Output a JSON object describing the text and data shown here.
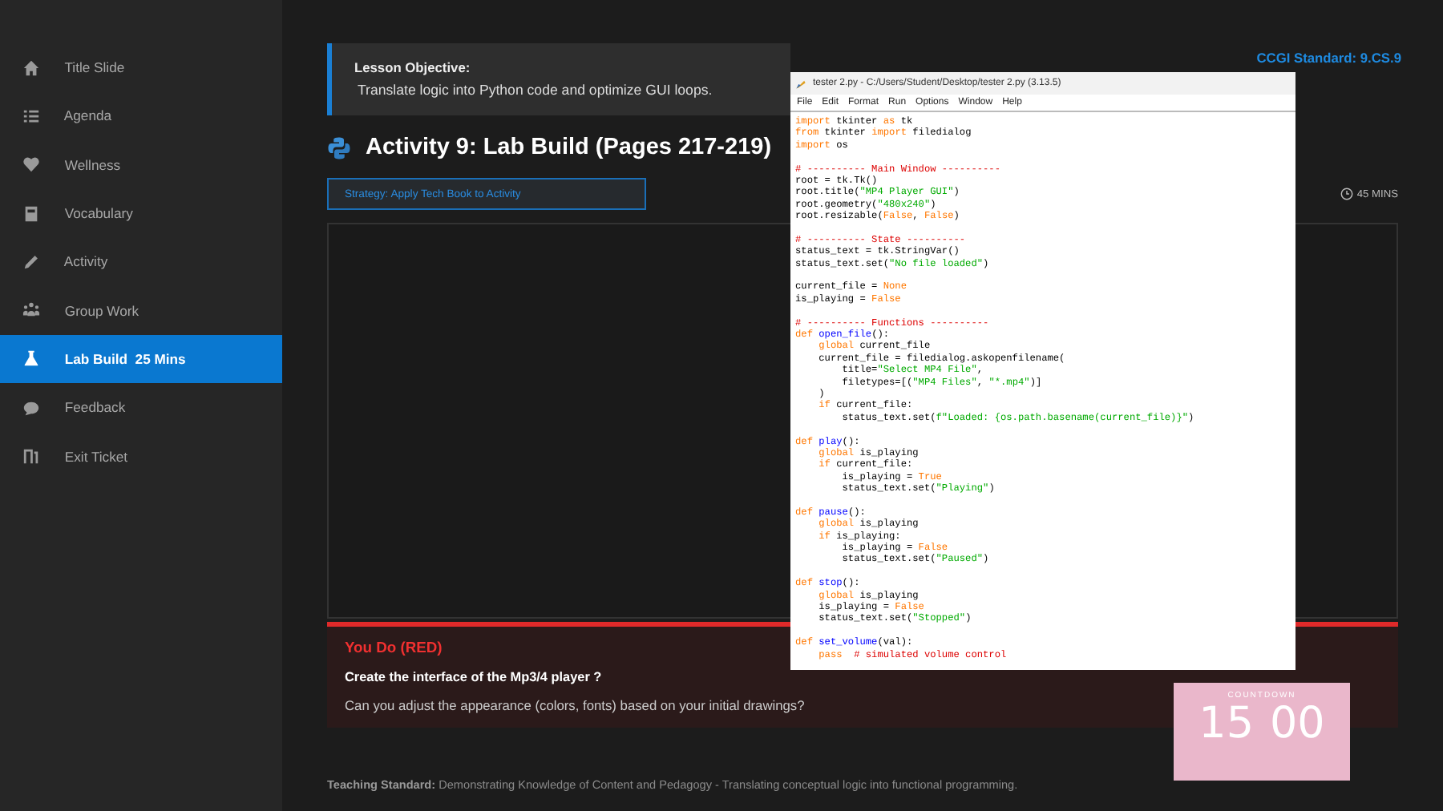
{
  "sidebar": {
    "items": [
      {
        "label": "Title Slide",
        "selected": false
      },
      {
        "label": "Agenda",
        "selected": false
      },
      {
        "label": "Wellness",
        "selected": false
      },
      {
        "label": "Vocabulary",
        "selected": false
      },
      {
        "label": "Activity",
        "selected": false
      },
      {
        "label": "Group Work",
        "selected": false
      },
      {
        "label": "Lab Build  25 Mins",
        "selected": true
      },
      {
        "label": "Feedback",
        "selected": false
      },
      {
        "label": "Exit Ticket",
        "selected": false
      }
    ]
  },
  "objective": {
    "heading": "Lesson Objective:",
    "text": "Translate logic into Python code and optimize GUI loops."
  },
  "standard_tag": "CCGI Standard: 9.CS.9",
  "title": "Activity 9: Lab Build (Pages 217-219)",
  "strategy_button": "Strategy: Apply Tech Book to Activity",
  "duration": "45 MINS",
  "editor": {
    "title": "tester 2.py - C:/Users/Student/Desktop/tester 2.py (3.13.5)",
    "menu": [
      "File",
      "Edit",
      "Format",
      "Run",
      "Options",
      "Window",
      "Help"
    ],
    "lines": [
      {
        "kind": "code",
        "segments": [
          {
            "kind": "keyword",
            "text": "import"
          },
          {
            "kind": "plain",
            "text": " tkinter "
          },
          {
            "kind": "keyword",
            "text": "as"
          },
          {
            "kind": "plain",
            "text": " tk"
          }
        ]
      },
      {
        "kind": "code",
        "segments": [
          {
            "kind": "keyword",
            "text": "from"
          },
          {
            "kind": "plain",
            "text": " tkinter "
          },
          {
            "kind": "keyword",
            "text": "import"
          },
          {
            "kind": "plain",
            "text": " filedialog"
          }
        ]
      },
      {
        "kind": "code",
        "segments": [
          {
            "kind": "keyword",
            "text": "import"
          },
          {
            "kind": "plain",
            "text": " os"
          }
        ]
      },
      {
        "kind": "blank"
      },
      {
        "kind": "code",
        "segments": [
          {
            "kind": "comment",
            "text": "# ---------- Main Window ----------"
          }
        ]
      },
      {
        "kind": "code",
        "segments": [
          {
            "kind": "plain",
            "text": "root = tk.Tk()"
          }
        ]
      },
      {
        "kind": "code",
        "segments": [
          {
            "kind": "plain",
            "text": "root.title("
          },
          {
            "kind": "string",
            "text": "\"MP4 Player GUI\""
          },
          {
            "kind": "plain",
            "text": ")"
          }
        ]
      },
      {
        "kind": "code",
        "segments": [
          {
            "kind": "plain",
            "text": "root.geometry("
          },
          {
            "kind": "string",
            "text": "\"480x240\""
          },
          {
            "kind": "plain",
            "text": ")"
          }
        ]
      },
      {
        "kind": "code",
        "segments": [
          {
            "kind": "plain",
            "text": "root.resizable("
          },
          {
            "kind": "keyword",
            "text": "False"
          },
          {
            "kind": "plain",
            "text": ", "
          },
          {
            "kind": "keyword",
            "text": "False"
          },
          {
            "kind": "plain",
            "text": ")"
          }
        ]
      },
      {
        "kind": "blank"
      },
      {
        "kind": "code",
        "segments": [
          {
            "kind": "comment",
            "text": "# ---------- State ----------"
          }
        ]
      },
      {
        "kind": "code",
        "segments": [
          {
            "kind": "plain",
            "text": "status_text = tk.StringVar()"
          }
        ]
      },
      {
        "kind": "code",
        "segments": [
          {
            "kind": "plain",
            "text": "status_text.set("
          },
          {
            "kind": "string",
            "text": "\"No file loaded\""
          },
          {
            "kind": "plain",
            "text": ")"
          }
        ]
      },
      {
        "kind": "blank"
      },
      {
        "kind": "code",
        "segments": [
          {
            "kind": "plain",
            "text": "current_file = "
          },
          {
            "kind": "keyword",
            "text": "None"
          }
        ]
      },
      {
        "kind": "code",
        "segments": [
          {
            "kind": "plain",
            "text": "is_playing = "
          },
          {
            "kind": "keyword",
            "text": "False"
          }
        ]
      },
      {
        "kind": "blank"
      },
      {
        "kind": "code",
        "segments": [
          {
            "kind": "comment",
            "text": "# ---------- Functions ----------"
          }
        ]
      },
      {
        "kind": "code",
        "segments": [
          {
            "kind": "keyword",
            "text": "def"
          },
          {
            "kind": "name",
            "text": " open_file"
          },
          {
            "kind": "plain",
            "text": "():"
          }
        ]
      },
      {
        "kind": "code",
        "segments": [
          {
            "kind": "keyword",
            "text": "    global"
          },
          {
            "kind": "plain",
            "text": " current_file"
          }
        ]
      },
      {
        "kind": "code",
        "segments": [
          {
            "kind": "plain",
            "text": "    current_file = filedialog.askopenfilename("
          }
        ]
      },
      {
        "kind": "code",
        "segments": [
          {
            "kind": "plain",
            "text": "        title="
          },
          {
            "kind": "string",
            "text": "\"Select MP4 File\""
          },
          {
            "kind": "plain",
            "text": ","
          }
        ]
      },
      {
        "kind": "code",
        "segments": [
          {
            "kind": "plain",
            "text": "        filetypes=[("
          },
          {
            "kind": "string",
            "text": "\"MP4 Files\""
          },
          {
            "kind": "plain",
            "text": ", "
          },
          {
            "kind": "string",
            "text": "\"*.mp4\""
          },
          {
            "kind": "plain",
            "text": ")]"
          }
        ]
      },
      {
        "kind": "code",
        "segments": [
          {
            "kind": "plain",
            "text": "    )"
          }
        ]
      },
      {
        "kind": "code",
        "segments": [
          {
            "kind": "keyword",
            "text": "    if"
          },
          {
            "kind": "plain",
            "text": " current_file:"
          }
        ]
      },
      {
        "kind": "code",
        "segments": [
          {
            "kind": "plain",
            "text": "        status_text.set("
          },
          {
            "kind": "string",
            "text": "f\"Loaded: {os.path.basename(current_file)}\""
          },
          {
            "kind": "plain",
            "text": ")"
          }
        ]
      },
      {
        "kind": "blank"
      },
      {
        "kind": "code",
        "segments": [
          {
            "kind": "keyword",
            "text": "def"
          },
          {
            "kind": "name",
            "text": " play"
          },
          {
            "kind": "plain",
            "text": "():"
          }
        ]
      },
      {
        "kind": "code",
        "segments": [
          {
            "kind": "keyword",
            "text": "    global"
          },
          {
            "kind": "plain",
            "text": " is_playing"
          }
        ]
      },
      {
        "kind": "code",
        "segments": [
          {
            "kind": "keyword",
            "text": "    if"
          },
          {
            "kind": "plain",
            "text": " current_file:"
          }
        ]
      },
      {
        "kind": "code",
        "segments": [
          {
            "kind": "plain",
            "text": "        is_playing = "
          },
          {
            "kind": "keyword",
            "text": "True"
          }
        ]
      },
      {
        "kind": "code",
        "segments": [
          {
            "kind": "plain",
            "text": "        status_text.set("
          },
          {
            "kind": "string",
            "text": "\"Playing\""
          },
          {
            "kind": "plain",
            "text": ")"
          }
        ]
      },
      {
        "kind": "blank"
      },
      {
        "kind": "code",
        "segments": [
          {
            "kind": "keyword",
            "text": "def"
          },
          {
            "kind": "name",
            "text": " pause"
          },
          {
            "kind": "plain",
            "text": "():"
          }
        ]
      },
      {
        "kind": "code",
        "segments": [
          {
            "kind": "keyword",
            "text": "    global"
          },
          {
            "kind": "plain",
            "text": " is_playing"
          }
        ]
      },
      {
        "kind": "code",
        "segments": [
          {
            "kind": "keyword",
            "text": "    if"
          },
          {
            "kind": "plain",
            "text": " is_playing:"
          }
        ]
      },
      {
        "kind": "code",
        "segments": [
          {
            "kind": "plain",
            "text": "        is_playing = "
          },
          {
            "kind": "keyword",
            "text": "False"
          }
        ]
      },
      {
        "kind": "code",
        "segments": [
          {
            "kind": "plain",
            "text": "        status_text.set("
          },
          {
            "kind": "string",
            "text": "\"Paused\""
          },
          {
            "kind": "plain",
            "text": ")"
          }
        ]
      },
      {
        "kind": "blank"
      },
      {
        "kind": "code",
        "segments": [
          {
            "kind": "keyword",
            "text": "def"
          },
          {
            "kind": "name",
            "text": " stop"
          },
          {
            "kind": "plain",
            "text": "():"
          }
        ]
      },
      {
        "kind": "code",
        "segments": [
          {
            "kind": "keyword",
            "text": "    global"
          },
          {
            "kind": "plain",
            "text": " is_playing"
          }
        ]
      },
      {
        "kind": "code",
        "segments": [
          {
            "kind": "plain",
            "text": "    is_playing = "
          },
          {
            "kind": "keyword",
            "text": "False"
          }
        ]
      },
      {
        "kind": "code",
        "segments": [
          {
            "kind": "plain",
            "text": "    status_text.set("
          },
          {
            "kind": "string",
            "text": "\"Stopped\""
          },
          {
            "kind": "plain",
            "text": ")"
          }
        ]
      },
      {
        "kind": "blank"
      },
      {
        "kind": "code",
        "segments": [
          {
            "kind": "keyword",
            "text": "def"
          },
          {
            "kind": "name",
            "text": " set_volume"
          },
          {
            "kind": "plain",
            "text": "(val):"
          }
        ]
      },
      {
        "kind": "code",
        "segments": [
          {
            "kind": "keyword",
            "text": "    pass"
          },
          {
            "kind": "comment",
            "text": "  # simulated volume control"
          }
        ]
      }
    ]
  },
  "you_do": {
    "heading": "You Do (RED)",
    "task": "Create the interface of the Mp3/4 player ?",
    "question": "Can you adjust the appearance (colors, fonts) based on your initial drawings?"
  },
  "countdown": {
    "label": "COUNTDOWN",
    "minutes": "15",
    "seconds": "00"
  },
  "footer": "**Teaching Standard:** Demonstrating Knowledge of Content and Pedagogy - Translating conceptual logic into functional programming."
}
